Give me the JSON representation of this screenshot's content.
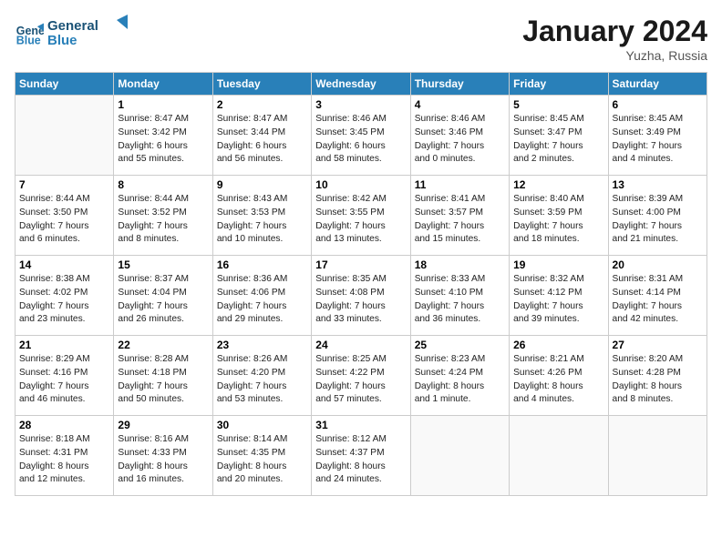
{
  "header": {
    "logo_line1": "General",
    "logo_line2": "Blue",
    "month_year": "January 2024",
    "location": "Yuzha, Russia"
  },
  "weekdays": [
    "Sunday",
    "Monday",
    "Tuesday",
    "Wednesday",
    "Thursday",
    "Friday",
    "Saturday"
  ],
  "rows": [
    [
      {
        "day": "",
        "lines": []
      },
      {
        "day": "1",
        "lines": [
          "Sunrise: 8:47 AM",
          "Sunset: 3:42 PM",
          "Daylight: 6 hours",
          "and 55 minutes."
        ]
      },
      {
        "day": "2",
        "lines": [
          "Sunrise: 8:47 AM",
          "Sunset: 3:44 PM",
          "Daylight: 6 hours",
          "and 56 minutes."
        ]
      },
      {
        "day": "3",
        "lines": [
          "Sunrise: 8:46 AM",
          "Sunset: 3:45 PM",
          "Daylight: 6 hours",
          "and 58 minutes."
        ]
      },
      {
        "day": "4",
        "lines": [
          "Sunrise: 8:46 AM",
          "Sunset: 3:46 PM",
          "Daylight: 7 hours",
          "and 0 minutes."
        ]
      },
      {
        "day": "5",
        "lines": [
          "Sunrise: 8:45 AM",
          "Sunset: 3:47 PM",
          "Daylight: 7 hours",
          "and 2 minutes."
        ]
      },
      {
        "day": "6",
        "lines": [
          "Sunrise: 8:45 AM",
          "Sunset: 3:49 PM",
          "Daylight: 7 hours",
          "and 4 minutes."
        ]
      }
    ],
    [
      {
        "day": "7",
        "lines": [
          "Sunrise: 8:44 AM",
          "Sunset: 3:50 PM",
          "Daylight: 7 hours",
          "and 6 minutes."
        ]
      },
      {
        "day": "8",
        "lines": [
          "Sunrise: 8:44 AM",
          "Sunset: 3:52 PM",
          "Daylight: 7 hours",
          "and 8 minutes."
        ]
      },
      {
        "day": "9",
        "lines": [
          "Sunrise: 8:43 AM",
          "Sunset: 3:53 PM",
          "Daylight: 7 hours",
          "and 10 minutes."
        ]
      },
      {
        "day": "10",
        "lines": [
          "Sunrise: 8:42 AM",
          "Sunset: 3:55 PM",
          "Daylight: 7 hours",
          "and 13 minutes."
        ]
      },
      {
        "day": "11",
        "lines": [
          "Sunrise: 8:41 AM",
          "Sunset: 3:57 PM",
          "Daylight: 7 hours",
          "and 15 minutes."
        ]
      },
      {
        "day": "12",
        "lines": [
          "Sunrise: 8:40 AM",
          "Sunset: 3:59 PM",
          "Daylight: 7 hours",
          "and 18 minutes."
        ]
      },
      {
        "day": "13",
        "lines": [
          "Sunrise: 8:39 AM",
          "Sunset: 4:00 PM",
          "Daylight: 7 hours",
          "and 21 minutes."
        ]
      }
    ],
    [
      {
        "day": "14",
        "lines": [
          "Sunrise: 8:38 AM",
          "Sunset: 4:02 PM",
          "Daylight: 7 hours",
          "and 23 minutes."
        ]
      },
      {
        "day": "15",
        "lines": [
          "Sunrise: 8:37 AM",
          "Sunset: 4:04 PM",
          "Daylight: 7 hours",
          "and 26 minutes."
        ]
      },
      {
        "day": "16",
        "lines": [
          "Sunrise: 8:36 AM",
          "Sunset: 4:06 PM",
          "Daylight: 7 hours",
          "and 29 minutes."
        ]
      },
      {
        "day": "17",
        "lines": [
          "Sunrise: 8:35 AM",
          "Sunset: 4:08 PM",
          "Daylight: 7 hours",
          "and 33 minutes."
        ]
      },
      {
        "day": "18",
        "lines": [
          "Sunrise: 8:33 AM",
          "Sunset: 4:10 PM",
          "Daylight: 7 hours",
          "and 36 minutes."
        ]
      },
      {
        "day": "19",
        "lines": [
          "Sunrise: 8:32 AM",
          "Sunset: 4:12 PM",
          "Daylight: 7 hours",
          "and 39 minutes."
        ]
      },
      {
        "day": "20",
        "lines": [
          "Sunrise: 8:31 AM",
          "Sunset: 4:14 PM",
          "Daylight: 7 hours",
          "and 42 minutes."
        ]
      }
    ],
    [
      {
        "day": "21",
        "lines": [
          "Sunrise: 8:29 AM",
          "Sunset: 4:16 PM",
          "Daylight: 7 hours",
          "and 46 minutes."
        ]
      },
      {
        "day": "22",
        "lines": [
          "Sunrise: 8:28 AM",
          "Sunset: 4:18 PM",
          "Daylight: 7 hours",
          "and 50 minutes."
        ]
      },
      {
        "day": "23",
        "lines": [
          "Sunrise: 8:26 AM",
          "Sunset: 4:20 PM",
          "Daylight: 7 hours",
          "and 53 minutes."
        ]
      },
      {
        "day": "24",
        "lines": [
          "Sunrise: 8:25 AM",
          "Sunset: 4:22 PM",
          "Daylight: 7 hours",
          "and 57 minutes."
        ]
      },
      {
        "day": "25",
        "lines": [
          "Sunrise: 8:23 AM",
          "Sunset: 4:24 PM",
          "Daylight: 8 hours",
          "and 1 minute."
        ]
      },
      {
        "day": "26",
        "lines": [
          "Sunrise: 8:21 AM",
          "Sunset: 4:26 PM",
          "Daylight: 8 hours",
          "and 4 minutes."
        ]
      },
      {
        "day": "27",
        "lines": [
          "Sunrise: 8:20 AM",
          "Sunset: 4:28 PM",
          "Daylight: 8 hours",
          "and 8 minutes."
        ]
      }
    ],
    [
      {
        "day": "28",
        "lines": [
          "Sunrise: 8:18 AM",
          "Sunset: 4:31 PM",
          "Daylight: 8 hours",
          "and 12 minutes."
        ]
      },
      {
        "day": "29",
        "lines": [
          "Sunrise: 8:16 AM",
          "Sunset: 4:33 PM",
          "Daylight: 8 hours",
          "and 16 minutes."
        ]
      },
      {
        "day": "30",
        "lines": [
          "Sunrise: 8:14 AM",
          "Sunset: 4:35 PM",
          "Daylight: 8 hours",
          "and 20 minutes."
        ]
      },
      {
        "day": "31",
        "lines": [
          "Sunrise: 8:12 AM",
          "Sunset: 4:37 PM",
          "Daylight: 8 hours",
          "and 24 minutes."
        ]
      },
      {
        "day": "",
        "lines": []
      },
      {
        "day": "",
        "lines": []
      },
      {
        "day": "",
        "lines": []
      }
    ]
  ]
}
